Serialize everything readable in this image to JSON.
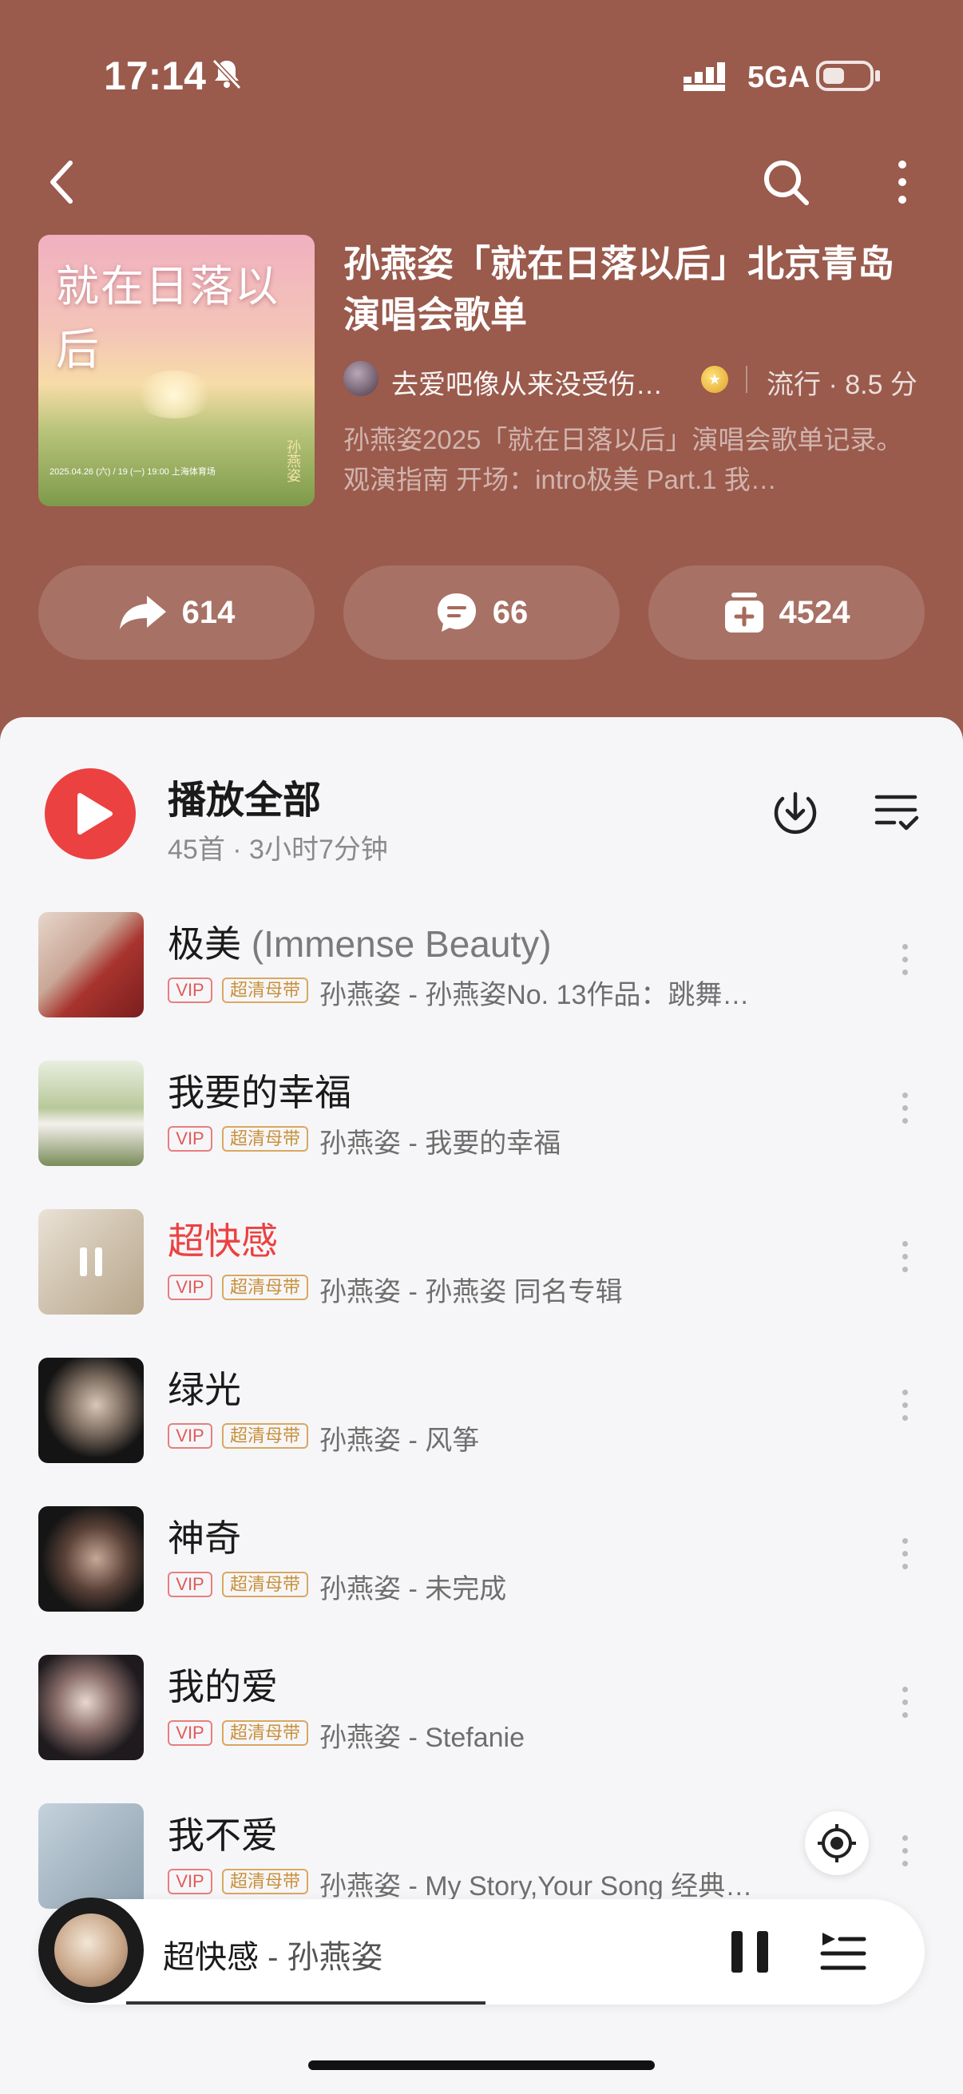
{
  "status": {
    "time": "17:14",
    "network": "5GA"
  },
  "playlist": {
    "title": "孙燕姿「就在日落以后」北京青岛演唱会歌单",
    "creator": "去爱吧像从来没受伤…",
    "genre": "流行 · 8.5 分",
    "description": "孙燕姿2025「就在日落以后」演唱会歌单记录。 观演指南 开场：intro极美 Part.1 我…",
    "cover": {
      "title": "就在日落以后",
      "artist": "孙燕姿",
      "note": "2025.04.26 (六) / 19 (一) 19:00 上海体育场"
    }
  },
  "actions": {
    "share": "614",
    "comment": "66",
    "collect": "4524"
  },
  "play_all": {
    "label": "播放全部",
    "meta": "45首 · 3小时7分钟"
  },
  "tags": {
    "vip": "VIP",
    "hq": "超清母带"
  },
  "songs": [
    {
      "title": "极美",
      "alt": " (Immense Beauty)",
      "sub": "孙燕姿 - 孙燕姿No. 13作品：跳舞…"
    },
    {
      "title": "我要的幸福",
      "alt": "",
      "sub": "孙燕姿 - 我要的幸福"
    },
    {
      "title": "超快感",
      "alt": "",
      "sub": "孙燕姿 - 孙燕姿 同名专辑"
    },
    {
      "title": "绿光",
      "alt": "",
      "sub": "孙燕姿 - 风筝"
    },
    {
      "title": "神奇",
      "alt": "",
      "sub": "孙燕姿 - 未完成"
    },
    {
      "title": "我的爱",
      "alt": "",
      "sub": "孙燕姿 - Stefanie"
    },
    {
      "title": "我不爱",
      "alt": "",
      "sub": "孙燕姿 - My Story,Your Song 经典…"
    }
  ],
  "now_playing": {
    "title": "超快感",
    "artist": " - 孙燕姿",
    "progress": 0.45
  },
  "colors": {
    "header": "#9a5a4c",
    "accent": "#ec4141"
  }
}
